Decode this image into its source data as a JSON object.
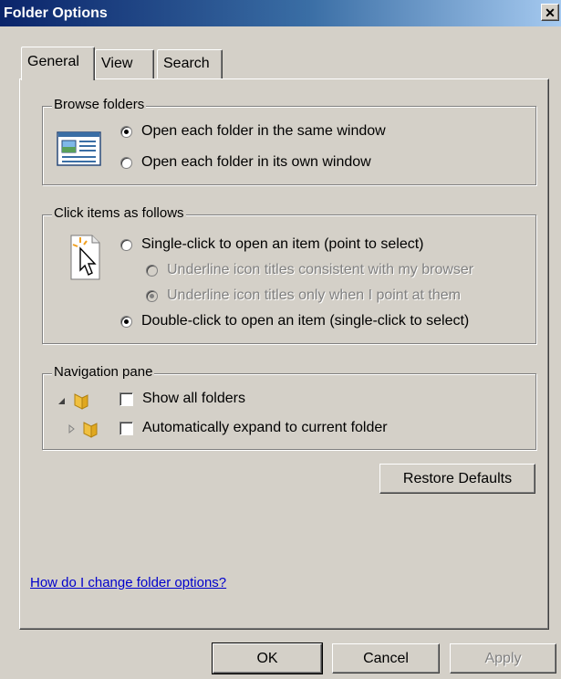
{
  "window": {
    "title": "Folder Options",
    "close_glyph": "✕"
  },
  "tabs": [
    {
      "label": "General",
      "active": true
    },
    {
      "label": "View",
      "active": false
    },
    {
      "label": "Search",
      "active": false
    }
  ],
  "browse_folders": {
    "legend": "Browse folders",
    "icon": "folder-window-icon",
    "options": [
      {
        "label": "Open each folder in the same window",
        "checked": true
      },
      {
        "label": "Open each folder in its own window",
        "checked": false
      }
    ]
  },
  "click_items": {
    "legend": "Click items as follows",
    "icon": "click-pointer-icon",
    "single_click": {
      "label": "Single-click to open an item (point to select)",
      "checked": false
    },
    "underline_consistent": {
      "label": "Underline icon titles consistent with my browser",
      "checked": false,
      "disabled": true
    },
    "underline_point": {
      "label": "Underline icon titles only when I point at them",
      "checked": true,
      "disabled": true
    },
    "double_click": {
      "label": "Double-click to open an item (single-click to select)",
      "checked": true
    }
  },
  "navigation_pane": {
    "legend": "Navigation pane",
    "show_all_folders": {
      "label": "Show all folders",
      "checked": false
    },
    "auto_expand": {
      "label": "Automatically expand to current folder",
      "checked": false
    }
  },
  "restore_defaults_label": "Restore Defaults",
  "help_link": "How do I change folder options?",
  "footer": {
    "ok_label": "OK",
    "cancel_label": "Cancel",
    "apply_label": "Apply"
  },
  "colors": {
    "title_bar": "#0a246a",
    "face": "#d4d0c8",
    "link": "#0000cc",
    "folder": "#e8b830"
  }
}
